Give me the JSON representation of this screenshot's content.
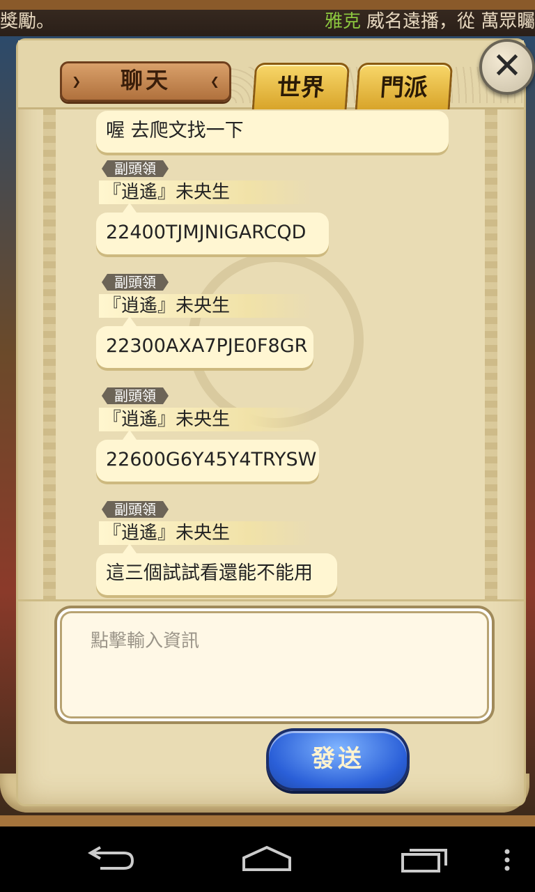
{
  "marquee": {
    "left_text": "獎勵。",
    "player_name": "雅克",
    "right_text": "威名遠播，從 萬眾矚"
  },
  "panel": {
    "title": "聊天",
    "tabs": [
      {
        "label": "世界"
      },
      {
        "label": "門派"
      }
    ],
    "close_icon": "close-icon"
  },
  "chat": {
    "messages": [
      {
        "text": "喔 去爬文找一下"
      },
      {
        "rank": "副頭領",
        "sender": "『逍遙』未央生",
        "text": "22400TJMJNIGARCQD"
      },
      {
        "rank": "副頭領",
        "sender": "『逍遙』未央生",
        "text": "22300AXA7PJE0F8GR"
      },
      {
        "rank": "副頭領",
        "sender": "『逍遙』未央生",
        "text": "22600G6Y45Y4TRYSW"
      },
      {
        "rank": "副頭領",
        "sender": "『逍遙』未央生",
        "text": "這三個試試看還能不能用"
      }
    ]
  },
  "input": {
    "placeholder": "點擊輸入資訊"
  },
  "send_button": {
    "label": "發送"
  },
  "navbar": {
    "icons": [
      "back-icon",
      "home-icon",
      "recent-apps-icon",
      "overflow-menu-icon"
    ]
  }
}
